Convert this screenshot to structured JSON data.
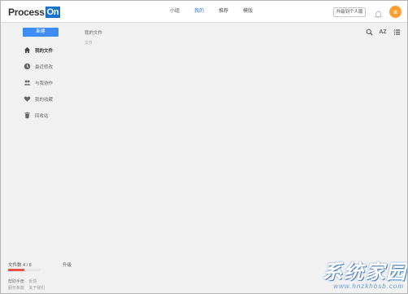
{
  "header": {
    "logo_text": "Process",
    "logo_badge": "On",
    "nav": [
      {
        "label": "小组"
      },
      {
        "label": "我的",
        "active": true
      },
      {
        "label": "推荐"
      },
      {
        "label": "模版"
      }
    ],
    "upgrade_label": "升级到个人版",
    "avatar_letter": "a",
    "accent_color": "#2d7ad8"
  },
  "sidebar": {
    "new_button": "新建",
    "items": [
      {
        "label": "我的文件",
        "icon": "home-icon",
        "active": true
      },
      {
        "label": "最近修改",
        "icon": "clock-icon"
      },
      {
        "label": "与我协作",
        "icon": "people-icon"
      },
      {
        "label": "我的收藏",
        "icon": "heart-icon"
      },
      {
        "label": "回收站",
        "icon": "trash-icon"
      }
    ]
  },
  "main": {
    "breadcrumb": "我的文件",
    "subtitle": "文件"
  },
  "toolbar": {
    "sort_label": "AZ"
  },
  "storage": {
    "label": "文件数 4 / 8",
    "upgrade": "升级",
    "used": 4,
    "total": 8
  },
  "footer": {
    "help": "帮助手册",
    "feedback": "反馈",
    "service": "服务条款",
    "about": "关于我们"
  },
  "watermark": {
    "title": "系统家园",
    "url": "www.hnzkhbsb.com"
  }
}
